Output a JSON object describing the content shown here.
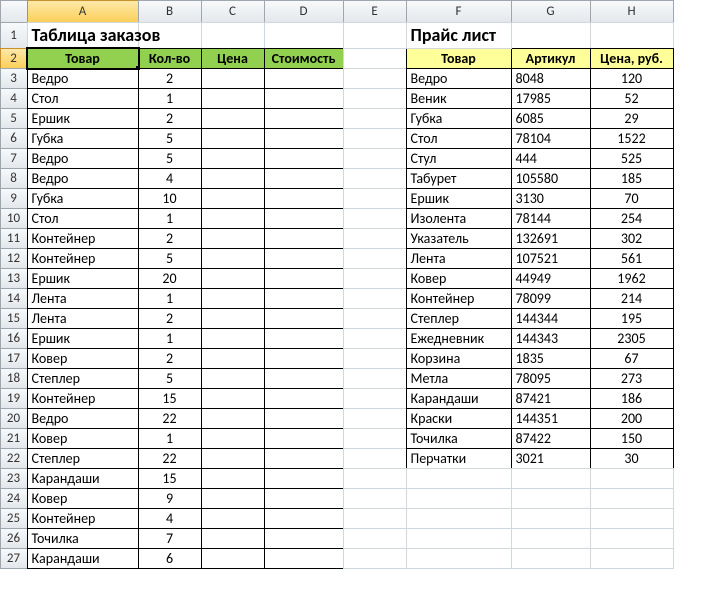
{
  "columns": [
    "A",
    "B",
    "C",
    "D",
    "E",
    "F",
    "G",
    "H"
  ],
  "active_column": "A",
  "active_row": 2,
  "titles": {
    "orders": "Таблица заказов",
    "price": "Прайс лист"
  },
  "orders_header": [
    "Товар",
    "Кол-во",
    "Цена",
    "Стоимость"
  ],
  "price_header": [
    "Товар",
    "Артикул",
    "Цена, руб."
  ],
  "orders": [
    {
      "name": "Ведро",
      "qty": 2
    },
    {
      "name": "Стол",
      "qty": 1
    },
    {
      "name": "Ершик",
      "qty": 2
    },
    {
      "name": "Губка",
      "qty": 5
    },
    {
      "name": "Ведро",
      "qty": 5
    },
    {
      "name": "Ведро",
      "qty": 4
    },
    {
      "name": "Губка",
      "qty": 10
    },
    {
      "name": "Стол",
      "qty": 1
    },
    {
      "name": "Контейнер",
      "qty": 2
    },
    {
      "name": "Контейнер",
      "qty": 5
    },
    {
      "name": "Ершик",
      "qty": 20
    },
    {
      "name": "Лента",
      "qty": 1
    },
    {
      "name": "Лента",
      "qty": 2
    },
    {
      "name": "Ершик",
      "qty": 1
    },
    {
      "name": "Ковер",
      "qty": 2
    },
    {
      "name": "Степлер",
      "qty": 5
    },
    {
      "name": "Контейнер",
      "qty": 15
    },
    {
      "name": "Ведро",
      "qty": 22
    },
    {
      "name": "Ковер",
      "qty": 1
    },
    {
      "name": "Степлер",
      "qty": 22
    },
    {
      "name": "Карандаши",
      "qty": 15
    },
    {
      "name": "Ковер",
      "qty": 9
    },
    {
      "name": "Контейнер",
      "qty": 4
    },
    {
      "name": "Точилка",
      "qty": 7
    },
    {
      "name": "Карандаши",
      "qty": 6
    }
  ],
  "prices": [
    {
      "name": "Ведро",
      "sku": "8048",
      "price": 120
    },
    {
      "name": "Веник",
      "sku": "17985",
      "price": 52
    },
    {
      "name": "Губка",
      "sku": "6085",
      "price": 29
    },
    {
      "name": "Стол",
      "sku": "78104",
      "price": 1522
    },
    {
      "name": "Стул",
      "sku": "444",
      "price": 525
    },
    {
      "name": "Табурет",
      "sku": "105580",
      "price": 185
    },
    {
      "name": "Ершик",
      "sku": "3130",
      "price": 70
    },
    {
      "name": "Изолента",
      "sku": "78144",
      "price": 254
    },
    {
      "name": "Указатель",
      "sku": "132691",
      "price": 302
    },
    {
      "name": "Лента",
      "sku": "107521",
      "price": 561
    },
    {
      "name": "Ковер",
      "sku": "44949",
      "price": 1962
    },
    {
      "name": "Контейнер",
      "sku": "78099",
      "price": 214
    },
    {
      "name": "Степлер",
      "sku": "144344",
      "price": 195
    },
    {
      "name": "Ежедневник",
      "sku": "144343",
      "price": 2305
    },
    {
      "name": "Корзина",
      "sku": "1835",
      "price": 67
    },
    {
      "name": "Метла",
      "sku": "78095",
      "price": 273
    },
    {
      "name": "Карандаши",
      "sku": "87421",
      "price": 186
    },
    {
      "name": "Краски",
      "sku": "144351",
      "price": 200
    },
    {
      "name": "Точилка",
      "sku": "87422",
      "price": 150
    },
    {
      "name": "Перчатки",
      "sku": "3021",
      "price": 30
    }
  ],
  "chart_data": [
    {
      "type": "table",
      "title": "Таблица заказов",
      "columns": [
        "Товар",
        "Кол-во",
        "Цена",
        "Стоимость"
      ],
      "rows": [
        [
          "Ведро",
          2,
          "",
          ""
        ],
        [
          "Стол",
          1,
          "",
          ""
        ],
        [
          "Ершик",
          2,
          "",
          ""
        ],
        [
          "Губка",
          5,
          "",
          ""
        ],
        [
          "Ведро",
          5,
          "",
          ""
        ],
        [
          "Ведро",
          4,
          "",
          ""
        ],
        [
          "Губка",
          10,
          "",
          ""
        ],
        [
          "Стол",
          1,
          "",
          ""
        ],
        [
          "Контейнер",
          2,
          "",
          ""
        ],
        [
          "Контейнер",
          5,
          "",
          ""
        ],
        [
          "Ершик",
          20,
          "",
          ""
        ],
        [
          "Лента",
          1,
          "",
          ""
        ],
        [
          "Лента",
          2,
          "",
          ""
        ],
        [
          "Ершик",
          1,
          "",
          ""
        ],
        [
          "Ковер",
          2,
          "",
          ""
        ],
        [
          "Степлер",
          5,
          "",
          ""
        ],
        [
          "Контейнер",
          15,
          "",
          ""
        ],
        [
          "Ведро",
          22,
          "",
          ""
        ],
        [
          "Ковер",
          1,
          "",
          ""
        ],
        [
          "Степлер",
          22,
          "",
          ""
        ],
        [
          "Карандаши",
          15,
          "",
          ""
        ],
        [
          "Ковер",
          9,
          "",
          ""
        ],
        [
          "Контейнер",
          4,
          "",
          ""
        ],
        [
          "Точилка",
          7,
          "",
          ""
        ],
        [
          "Карандаши",
          6,
          "",
          ""
        ]
      ]
    },
    {
      "type": "table",
      "title": "Прайс лист",
      "columns": [
        "Товар",
        "Артикул",
        "Цена, руб."
      ],
      "rows": [
        [
          "Ведро",
          "8048",
          120
        ],
        [
          "Веник",
          "17985",
          52
        ],
        [
          "Губка",
          "6085",
          29
        ],
        [
          "Стол",
          "78104",
          1522
        ],
        [
          "Стул",
          "444",
          525
        ],
        [
          "Табурет",
          "105580",
          185
        ],
        [
          "Ершик",
          "3130",
          70
        ],
        [
          "Изолента",
          "78144",
          254
        ],
        [
          "Указатель",
          "132691",
          302
        ],
        [
          "Лента",
          "107521",
          561
        ],
        [
          "Ковер",
          "44949",
          1962
        ],
        [
          "Контейнер",
          "78099",
          214
        ],
        [
          "Степлер",
          "144344",
          195
        ],
        [
          "Ежедневник",
          "144343",
          2305
        ],
        [
          "Корзина",
          "1835",
          67
        ],
        [
          "Метла",
          "78095",
          273
        ],
        [
          "Карандаши",
          "87421",
          186
        ],
        [
          "Краски",
          "144351",
          200
        ],
        [
          "Точилка",
          "87422",
          150
        ],
        [
          "Перчатки",
          "3021",
          30
        ]
      ]
    }
  ]
}
